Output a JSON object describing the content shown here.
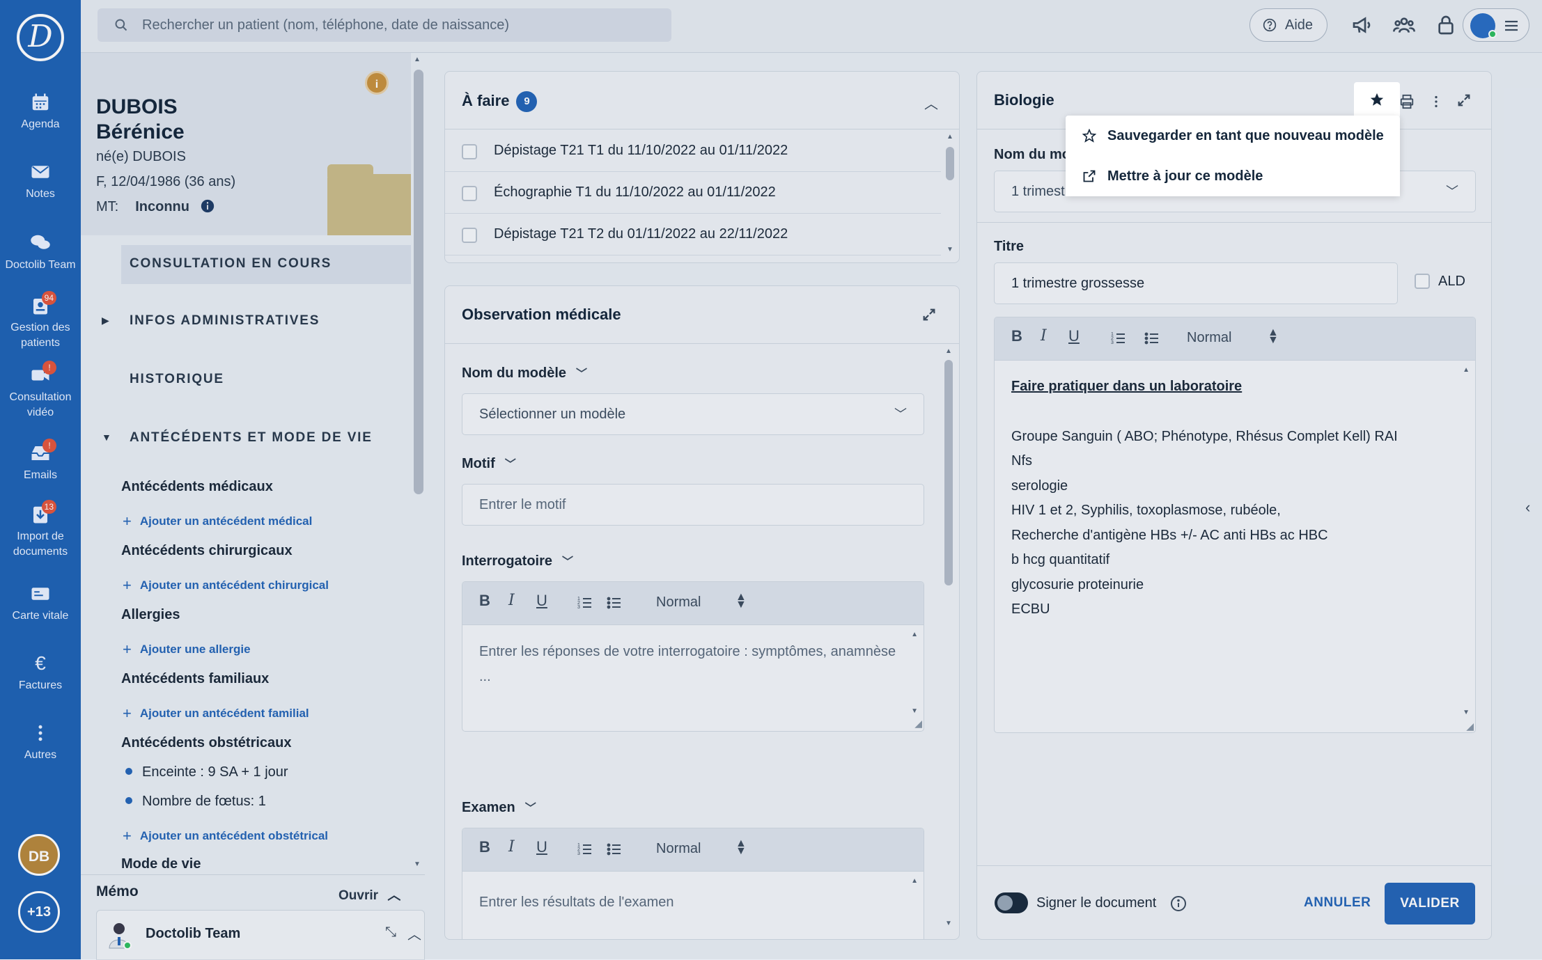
{
  "nav": {
    "items": [
      {
        "label": "Agenda",
        "icon": "calendar-icon"
      },
      {
        "label": "Notes",
        "icon": "mail-icon"
      },
      {
        "label": "Doctolib Team",
        "icon": "chat-icon"
      },
      {
        "label": "Gestion des patients",
        "icon": "patients-icon",
        "badge": "94"
      },
      {
        "label": "Consultation vidéo",
        "icon": "video-icon",
        "badge": "!"
      },
      {
        "label": "Emails",
        "icon": "inbox-icon",
        "badge": "!"
      },
      {
        "label": "Import de documents",
        "icon": "import-icon",
        "badge": "13"
      },
      {
        "label": "Carte vitale",
        "icon": "card-icon"
      },
      {
        "label": "Factures",
        "icon": "euro-icon"
      },
      {
        "label": "Autres",
        "icon": "more-vertical-icon"
      }
    ],
    "user_initials": "DB",
    "more_count": "+13"
  },
  "topbar": {
    "search_placeholder": "Rechercher un patient (nom, téléphone, date de naissance)",
    "help_label": "Aide"
  },
  "patient": {
    "last_name": "DUBOIS",
    "first_name": "Bérénice",
    "born_name": "né(e) DUBOIS",
    "sex_dob": "F, 12/04/1986 (36 ans)",
    "mt_label": "MT:",
    "mt_value": "Inconnu",
    "info_badge": "i"
  },
  "sidebar_sections": {
    "current": "CONSULTATION EN COURS",
    "admin": "INFOS ADMINISTRATIVES",
    "history": "HISTORIQUE",
    "antecedents": "ANTÉCÉDENTS ET MODE DE VIE"
  },
  "antecedents": {
    "medical": {
      "title": "Antécédents médicaux",
      "add": "Ajouter un antécédent médical"
    },
    "surgical": {
      "title": "Antécédents chirurgicaux",
      "add": "Ajouter un antécédent chirurgical"
    },
    "allergies": {
      "title": "Allergies",
      "add": "Ajouter une allergie"
    },
    "family": {
      "title": "Antécédents familiaux",
      "add": "Ajouter un antécédent familial"
    },
    "obstetric": {
      "title": "Antécédents obstétricaux",
      "items": [
        "Enceinte : 9 SA + 1 jour",
        "Nombre de fœtus: 1"
      ],
      "add": "Ajouter un antécédent obstétrical"
    },
    "lifestyle": {
      "title": "Mode de vie"
    }
  },
  "memo": {
    "title": "Mémo",
    "open_label": "Ouvrir",
    "team_name": "Doctolib Team"
  },
  "todo": {
    "title": "À faire",
    "count": "9",
    "items": [
      "Dépistage T21 T1 du 11/10/2022 au 01/11/2022",
      "Échographie T1 du 11/10/2022 au 01/11/2022",
      "Dépistage T21 T2 du 01/11/2022 au 22/11/2022"
    ]
  },
  "observation": {
    "title": "Observation médicale",
    "model_label": "Nom du modèle",
    "model_placeholder": "Sélectionner un modèle",
    "motif_label": "Motif",
    "motif_placeholder": "Entrer le motif",
    "interro_label": "Interrogatoire",
    "interro_placeholder_1": "Entrer les réponses de votre interrogatoire : symptômes, anamnèse",
    "interro_placeholder_2": "...",
    "exam_label": "Examen",
    "exam_placeholder": "Entrer les résultats de l'examen"
  },
  "toolbar": {
    "bold": "B",
    "italic": "I",
    "underline": "U",
    "style": "Normal"
  },
  "biologie": {
    "title": "Biologie",
    "model_label": "Nom du mo",
    "model_value": "1 trimest",
    "title_label": "Titre",
    "title_value": "1 trimestre grossesse",
    "ald_label": "ALD",
    "heading": "Faire pratiquer dans un laboratoire",
    "lines": [
      "Groupe Sanguin ( ABO; Phénotype, Rhésus Complet Kell) RAI",
      "Nfs",
      "serologie",
      "HIV 1 et 2, Syphilis, toxoplasmose, rubéole,",
      "Recherche d'antigène HBs +/-  AC anti HBs ac HBC",
      "b hcg quantitatif",
      "glycosurie proteinurie",
      "ECBU"
    ],
    "sign_label": "Signer le document",
    "cancel": "ANNULER",
    "validate": "VALIDER"
  },
  "dropdown": {
    "save_new": "Sauvegarder en tant que nouveau modèle",
    "update": "Mettre à jour ce modèle"
  },
  "colors": {
    "nav_bg": "#1f63b5",
    "accent": "#2565b7",
    "badge": "#e4573d"
  }
}
